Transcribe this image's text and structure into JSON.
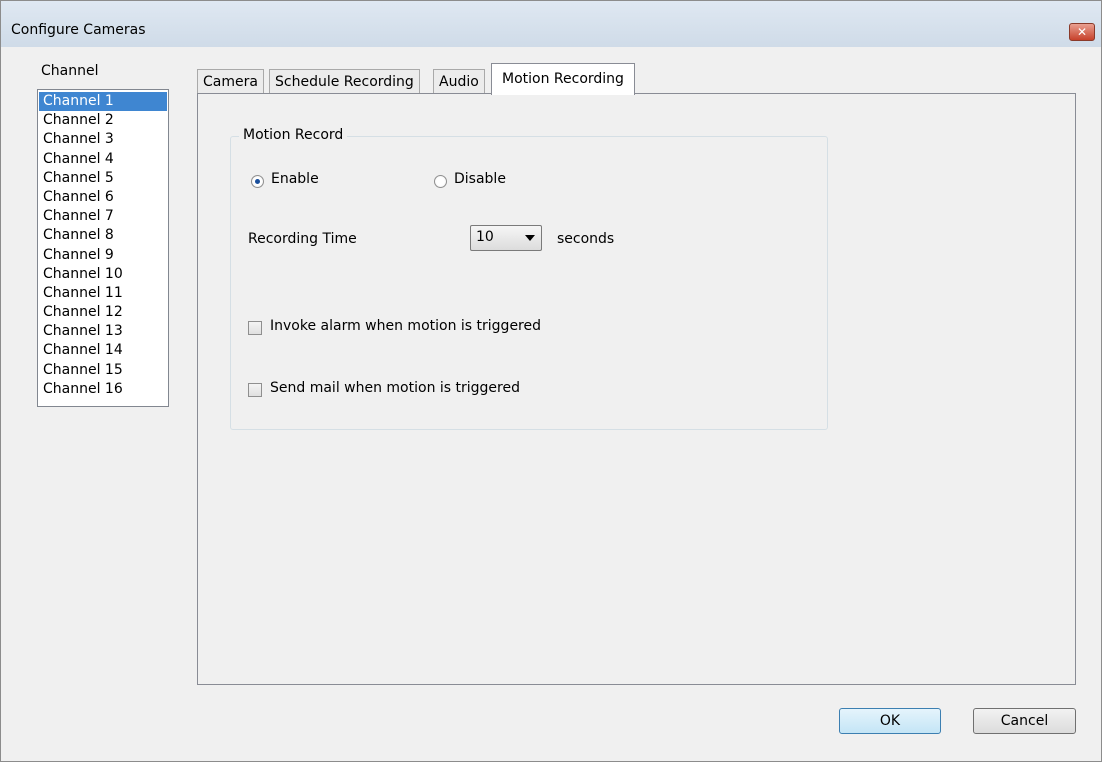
{
  "window": {
    "title": "Configure Cameras",
    "close_icon": "close-icon"
  },
  "channel": {
    "label": "Channel",
    "items": [
      "Channel 1",
      "Channel 2",
      "Channel 3",
      "Channel 4",
      "Channel 5",
      "Channel 6",
      "Channel 7",
      "Channel 8",
      "Channel 9",
      "Channel 10",
      "Channel 11",
      "Channel 12",
      "Channel 13",
      "Channel 14",
      "Channel 15",
      "Channel 16"
    ],
    "selected": "Channel 1"
  },
  "tabs": [
    "Camera",
    "Schedule Recording",
    "Audio",
    "Motion Recording"
  ],
  "active_tab": "Motion Recording",
  "motion": {
    "group_title": "Motion Record",
    "enable_label": "Enable",
    "disable_label": "Disable",
    "enabled": true,
    "recording_time_label": "Recording Time",
    "recording_time_value": "10",
    "seconds_label": "seconds",
    "invoke_alarm_label": "Invoke alarm when motion is triggered",
    "invoke_alarm_checked": false,
    "send_mail_label": "Send mail when motion is triggered",
    "send_mail_checked": false
  },
  "buttons": {
    "ok": "OK",
    "cancel": "Cancel"
  }
}
